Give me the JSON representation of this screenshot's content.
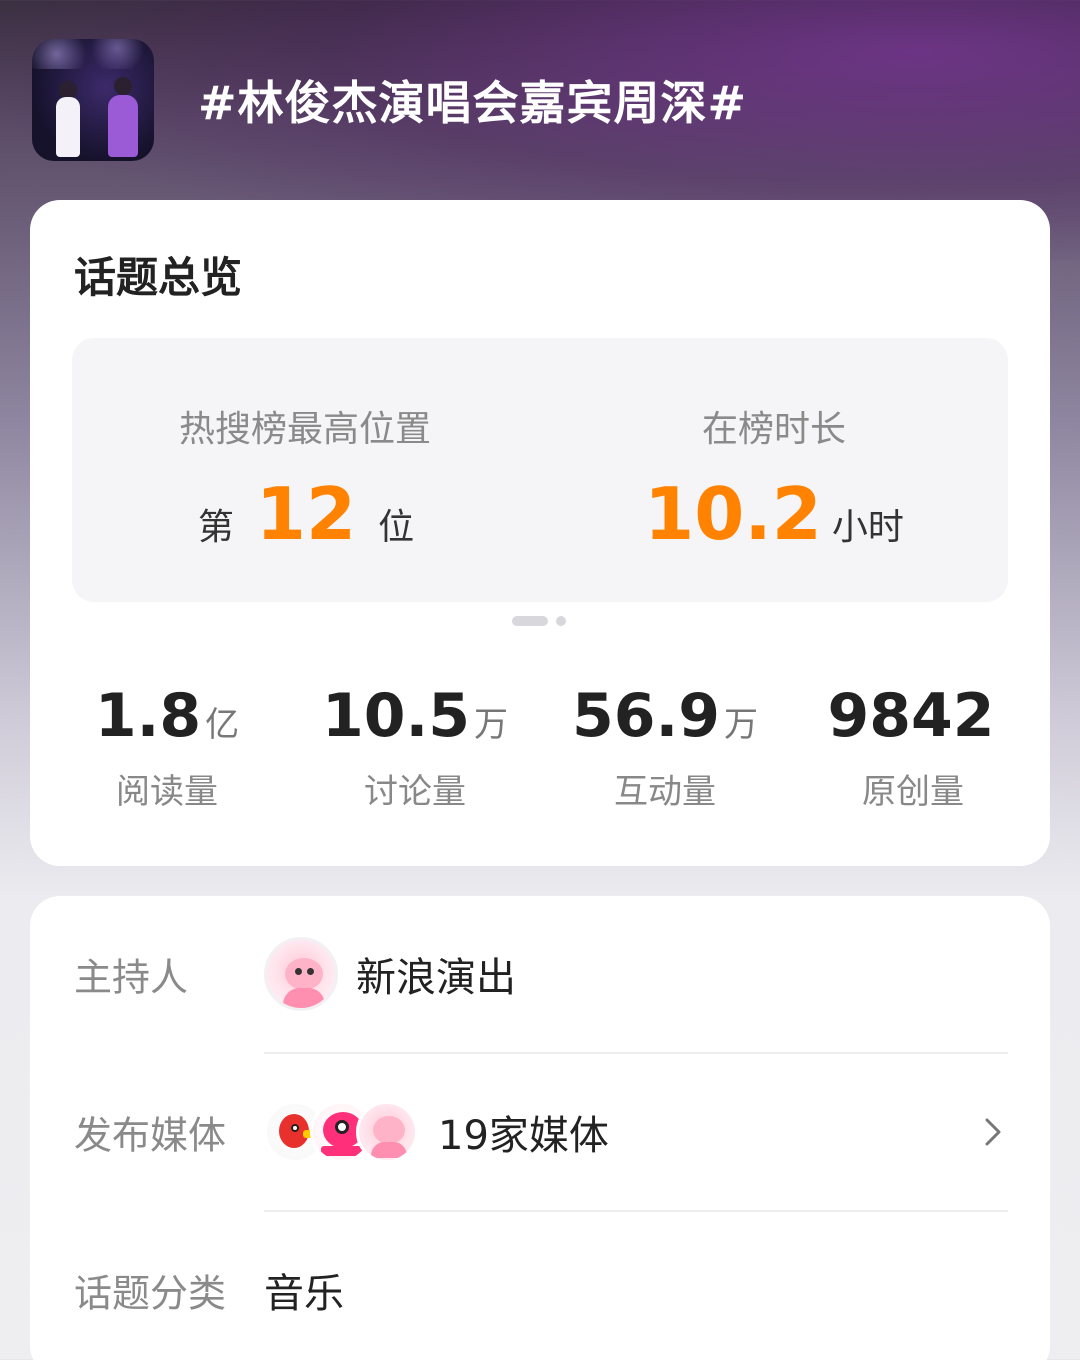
{
  "topic": {
    "title": "#林俊杰演唱会嘉宾周深#"
  },
  "overview": {
    "title": "话题总览",
    "rank": {
      "label": "热搜榜最高位置",
      "prefix": "第",
      "value": "12",
      "suffix": "位"
    },
    "duration": {
      "label": "在榜时长",
      "value": "10.2",
      "unit": "小时"
    },
    "carousel": {
      "pages": 2,
      "active": 1
    },
    "stats": [
      {
        "value": "1.8",
        "unit": "亿",
        "label": "阅读量"
      },
      {
        "value": "10.5",
        "unit": "万",
        "label": "讨论量"
      },
      {
        "value": "56.9",
        "unit": "万",
        "label": "互动量"
      },
      {
        "value": "9842",
        "unit": "",
        "label": "原创量"
      }
    ]
  },
  "info": {
    "host": {
      "label": "主持人",
      "name": "新浪演出",
      "avatar_icon": "pink-mascot-icon"
    },
    "media": {
      "label": "发布媒体",
      "text": "19家媒体",
      "avatar_icons": [
        "red-bird-logo-icon",
        "pink-mascot-logo-icon",
        "pink-mascot-icon"
      ],
      "chevron_icon": "chevron-right-icon"
    },
    "category": {
      "label": "话题分类",
      "value": "音乐"
    }
  },
  "colors": {
    "accent": "#ff8200",
    "card_bg": "#ffffff",
    "label_gray": "#8a8a8a"
  }
}
